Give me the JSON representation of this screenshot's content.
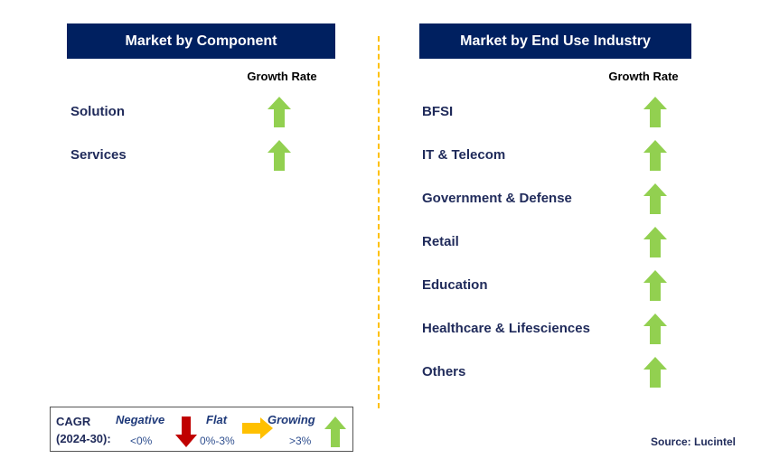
{
  "left": {
    "title": "Market by Component",
    "growth_label": "Growth Rate",
    "items": [
      {
        "label": "Solution",
        "trend": "growing"
      },
      {
        "label": "Services",
        "trend": "growing"
      }
    ]
  },
  "right": {
    "title": "Market by End Use Industry",
    "growth_label": "Growth Rate",
    "items": [
      {
        "label": "BFSI",
        "trend": "growing"
      },
      {
        "label": "IT & Telecom",
        "trend": "growing"
      },
      {
        "label": "Government & Defense",
        "trend": "growing"
      },
      {
        "label": "Retail",
        "trend": "growing"
      },
      {
        "label": "Education",
        "trend": "growing"
      },
      {
        "label": "Healthcare & Lifesciences",
        "trend": "growing"
      },
      {
        "label": "Others",
        "trend": "growing"
      }
    ]
  },
  "legend": {
    "cagr": "CAGR",
    "period": "(2024-30):",
    "negative": "Negative",
    "negative_range": "<0%",
    "flat": "Flat",
    "flat_range": "0%-3%",
    "growing": "Growing",
    "growing_range": ">3%"
  },
  "source": "Source: Lucintel",
  "colors": {
    "header": "#002060",
    "growing": "#92D050",
    "negative": "#C00000",
    "flat": "#FFC000",
    "divider": "#FFC000"
  }
}
